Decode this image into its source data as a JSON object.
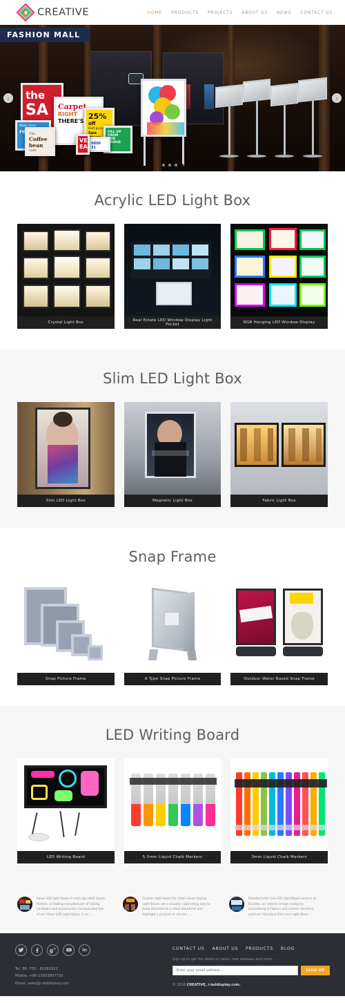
{
  "header": {
    "logo_text": "CREATIVE",
    "logo_icon": "rainbow-diamond-c-logo",
    "nav": [
      {
        "label": "HOME",
        "active": true
      },
      {
        "label": "PRODUCTS",
        "active": false
      },
      {
        "label": "PROJECTS",
        "active": false
      },
      {
        "label": "ABOUT US",
        "active": false
      },
      {
        "label": "NEWS",
        "active": false
      },
      {
        "label": "CONTACT US",
        "active": false
      }
    ]
  },
  "hero": {
    "banner_label": "FASHION MALL",
    "prev_icon": "chevron-left-icon",
    "next_icon": "chevron-right-icon",
    "prev_glyph": "‹",
    "next_glyph": "›",
    "dots": 4,
    "active_dot": 3,
    "posters": [
      {
        "line1": "the",
        "line2": "SA"
      },
      {
        "line1": "Carpet",
        "line2": "RIGHT",
        "line3": "THERE'S"
      },
      {
        "line1": "25%",
        "line2": "off",
        "line3": "Half price",
        "line4": "Sale",
        "line5": "Insure"
      },
      {
        "line1": "Make drive",
        "line2": "reward"
      },
      {
        "line1": "The",
        "line2": "Coffee",
        "line3": "bean",
        "line4": "cafe"
      },
      {
        "line1": "FILL UP FROM",
        "line2": "OUR FRIDGE"
      },
      {
        "line1": "0800 31"
      },
      {
        "line1": "VE",
        "line2": "EA"
      }
    ]
  },
  "sections": [
    {
      "title": "Acrylic LED Light Box",
      "alt": false,
      "cards": [
        {
          "caption": "Crystal Light Box",
          "art": "crystal"
        },
        {
          "caption": "Real Estate LED Window Display Light Pocket",
          "art": "realestate"
        },
        {
          "caption": "RGB Hanging LED Window Display",
          "art": "rgb"
        }
      ]
    },
    {
      "title": "Slim LED Light Box",
      "alt": true,
      "cards": [
        {
          "caption": "Slim LED Light Box",
          "art": "slim"
        },
        {
          "caption": "Magnetic Light Box",
          "art": "magnetic"
        },
        {
          "caption": "Fabric Light Box",
          "art": "fabric"
        }
      ]
    },
    {
      "title": "Snap Frame",
      "alt": false,
      "cards": [
        {
          "caption": "Snap Picture Frame",
          "art": "snapframe"
        },
        {
          "caption": "A Type Snap Picture Frame",
          "art": "atype"
        },
        {
          "caption": "Outdoor Water Based Snap Frame",
          "art": "outdoor"
        }
      ]
    },
    {
      "title": "LED Writing Board",
      "alt": true,
      "cards": [
        {
          "caption": "LED Writing Board",
          "art": "writingboard"
        },
        {
          "caption": "5.5mm Liquid Chalk Markers",
          "art": "markers55"
        },
        {
          "caption": "3mm Liquid Chalk Markers",
          "art": "markers3"
        }
      ]
    }
  ],
  "testimonials": [
    {
      "avatar": "news-thumbnail-1",
      "line1": "Value LED light boxes in end cap retail displa",
      "line2": "Harken, a leading manufacturer of sailing",
      "line3": "hardware and accessories, incorporated two",
      "line4": "of our Value LED Light Boxes in an ...."
    },
    {
      "avatar": "news-thumbnail-2",
      "line1": "Custom light boxes for retail visual display",
      "line2": "Light Boxes are a visually captivating way to",
      "line3": "draw attention to a retail storefront and",
      "line4": "highlight a product or service. ..."
    },
    {
      "avatar": "news-thumbnail-3",
      "line1": "Standard slim line LED light Boxes used in dc",
      "line2": "Duralee, an interior design company",
      "line3": "specializing in fabrics and custom furniture,",
      "line4": "used our Standard Slim Line Light Boxe..."
    }
  ],
  "footer": {
    "social": [
      {
        "name": "twitter-icon",
        "glyph": "🐦"
      },
      {
        "name": "facebook-icon",
        "glyph": "f"
      },
      {
        "name": "google-plus-icon",
        "glyph": "g⁺"
      },
      {
        "name": "youtube-icon",
        "glyph": "▶"
      },
      {
        "name": "linkedin-icon",
        "glyph": "in"
      }
    ],
    "contact": [
      "Tel: 86 -755 - 85282922",
      "Mobile: +86-15003897730",
      "Email: sales@i-leddisplay.com"
    ],
    "nav": [
      "CONTACT US",
      "ABOUT US",
      "PRODUCTS",
      "BLOG"
    ],
    "signup_note": "Sign up to get the latest on sales, new releases and more ...",
    "email_placeholder": "Enter your email address ..",
    "email_value": "",
    "signup_button": "SIGN UP",
    "copyright_prefix": "© 2016 ",
    "copyright_brand": "CREATIVE, i-leddisplay.com.",
    "colors": {
      "accent": "#f5a623",
      "background": "#2b2f33",
      "nav_active": "#f4846b"
    }
  }
}
